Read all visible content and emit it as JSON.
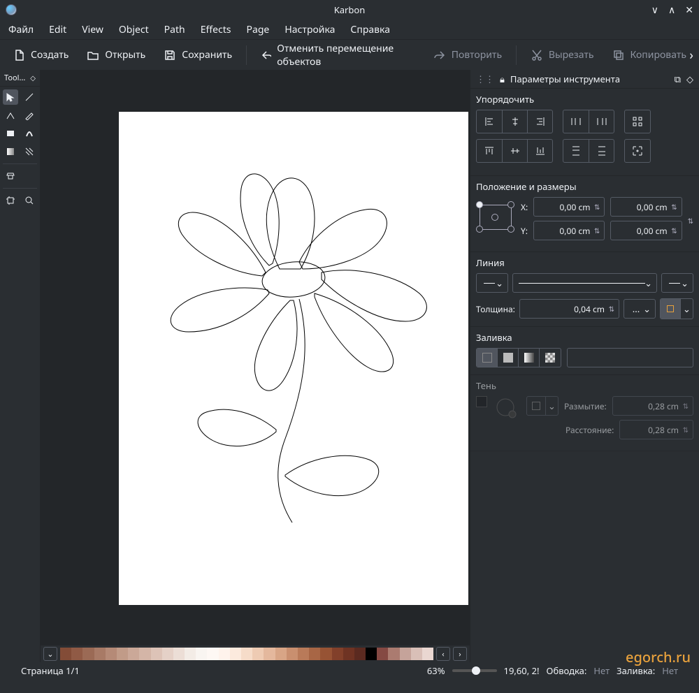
{
  "app": {
    "title": "Karbon"
  },
  "menu": [
    "Файл",
    "Edit",
    "View",
    "Object",
    "Path",
    "Effects",
    "Page",
    "Настройка",
    "Справка"
  ],
  "toolbar": {
    "create": "Создать",
    "open": "Открыть",
    "save": "Сохранить",
    "undo": "Отменить перемещение объектов",
    "redo": "Повторить",
    "cut": "Вырезать",
    "copy": "Копировать"
  },
  "left_dock": {
    "title": "Tool..."
  },
  "right": {
    "title": "Параметры инструмента",
    "arrange": "Упорядочить",
    "position_size": "Положение и размеры",
    "x_label": "X:",
    "y_label": "Y:",
    "x_val": "0,00 cm",
    "y_val": "0,00 cm",
    "w_val": "0,00 cm",
    "h_val": "0,00 cm",
    "line": "Линия",
    "width_label": "Толщина:",
    "width_val": "0,04 cm",
    "width_more": "...",
    "fill": "Заливка",
    "shadow": "Тень",
    "blur_label": "Размытие:",
    "blur_val": "0,28 cm",
    "dist_label": "Расстояние:",
    "dist_val": "0,28 cm"
  },
  "palette_colors": [
    "#834c37",
    "#905a45",
    "#9b6a55",
    "#a87a66",
    "#b58a77",
    "#c19b88",
    "#cba898",
    "#d4b5a7",
    "#ddc3b7",
    "#e5d1c7",
    "#ecded6",
    "#f3ece6",
    "#f9f5f1",
    "#fef8f4",
    "#fff3ec",
    "#fceadd",
    "#f6dcc9",
    "#eecbb3",
    "#e4b89d",
    "#d8a586",
    "#c98f6f",
    "#b97a59",
    "#a86645",
    "#975334",
    "#82402a",
    "#6f3323",
    "#5b2a20",
    "#000000",
    "#854943",
    "#ab7b70",
    "#c5a39a",
    "#d9bfb7",
    "#ead7d1"
  ],
  "status": {
    "page": "Страница 1/1",
    "zoom": "63%",
    "coords": "19,60, 2!",
    "stroke_label": "Обводка:",
    "stroke_val": "Нет",
    "fill_label": "Заливка:",
    "fill_val": "Нет"
  },
  "brand": "egorch.ru"
}
